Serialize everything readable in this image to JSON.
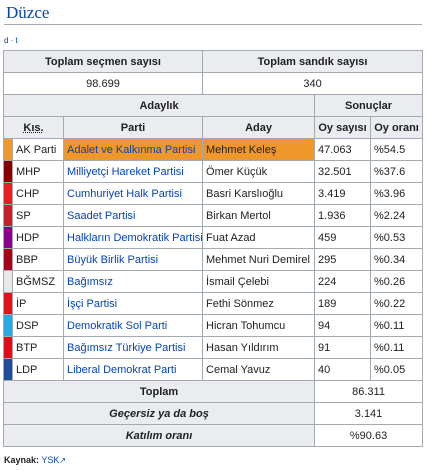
{
  "title": "Düzce",
  "vde": "d · t",
  "headers": {
    "voters": "Toplam seçmen sayısı",
    "boxes": "Toplam sandık sayısı",
    "candidacy": "Adaylık",
    "results": "Sonuçlar",
    "abbr": "Kıs.",
    "party": "Parti",
    "candidate": "Aday",
    "votes": "Oy sayısı",
    "share": "Oy oranı"
  },
  "voters_value": "98.699",
  "boxes_value": "340",
  "rows": [
    {
      "abbr": "AK Parti",
      "party": "Adalet ve Kalkınma Partisi",
      "candidate": "Mehmet Keleş",
      "votes": "47.063",
      "share": "%54.5",
      "color": "#f0972b"
    },
    {
      "abbr": "MHP",
      "party": "Milliyetçi Hareket Partisi",
      "candidate": "Ömer Küçük",
      "votes": "32.501",
      "share": "%37.6",
      "color": "#870000"
    },
    {
      "abbr": "CHP",
      "party": "Cumhuriyet Halk Partisi",
      "candidate": "Basri Karslıoğlu",
      "votes": "3.419",
      "share": "%3.96",
      "color": "#ed1c24"
    },
    {
      "abbr": "SP",
      "party": "Saadet Partisi",
      "candidate": "Birkan Mertol",
      "votes": "1.936",
      "share": "%2.24",
      "color": "#c61e2a"
    },
    {
      "abbr": "HDP",
      "party": "Halkların Demokratik Partisi",
      "candidate": "Fuat Azad",
      "votes": "459",
      "share": "%0.53",
      "color": "#8b008b"
    },
    {
      "abbr": "BBP",
      "party": "Büyük Birlik Partisi",
      "candidate": "Mehmet Nuri Demirel",
      "votes": "295",
      "share": "%0.34",
      "color": "#a50014"
    },
    {
      "abbr": "BĞMSZ",
      "party": "Bağımsız",
      "candidate": "İsmail Çelebi",
      "votes": "224",
      "share": "%0.26",
      "color": "#e8e8e8"
    },
    {
      "abbr": "İP",
      "party": "İşçi Partisi",
      "candidate": "Fethi Sönmez",
      "votes": "189",
      "share": "%0.22",
      "color": "#e0131a"
    },
    {
      "abbr": "DSP",
      "party": "Demokratik Sol Parti",
      "candidate": "Hicran Tohumcu",
      "votes": "94",
      "share": "%0.11",
      "color": "#27aae1"
    },
    {
      "abbr": "BTP",
      "party": "Bağımsız Türkiye Partisi",
      "candidate": "Hasan Yıldırım",
      "votes": "91",
      "share": "%0.11",
      "color": "#e30a17"
    },
    {
      "abbr": "LDP",
      "party": "Liberal Demokrat Parti",
      "candidate": "Cemal Yavuz",
      "votes": "40",
      "share": "%0.05",
      "color": "#1f4e9a"
    }
  ],
  "totals": [
    {
      "label": "Toplam",
      "value": "86.311"
    },
    {
      "label": "Geçersiz ya da boş",
      "value": "3.141"
    },
    {
      "label": "Katılım oranı",
      "value": "%90.63"
    }
  ],
  "source_label": "Kaynak:",
  "source_link": "YSK"
}
